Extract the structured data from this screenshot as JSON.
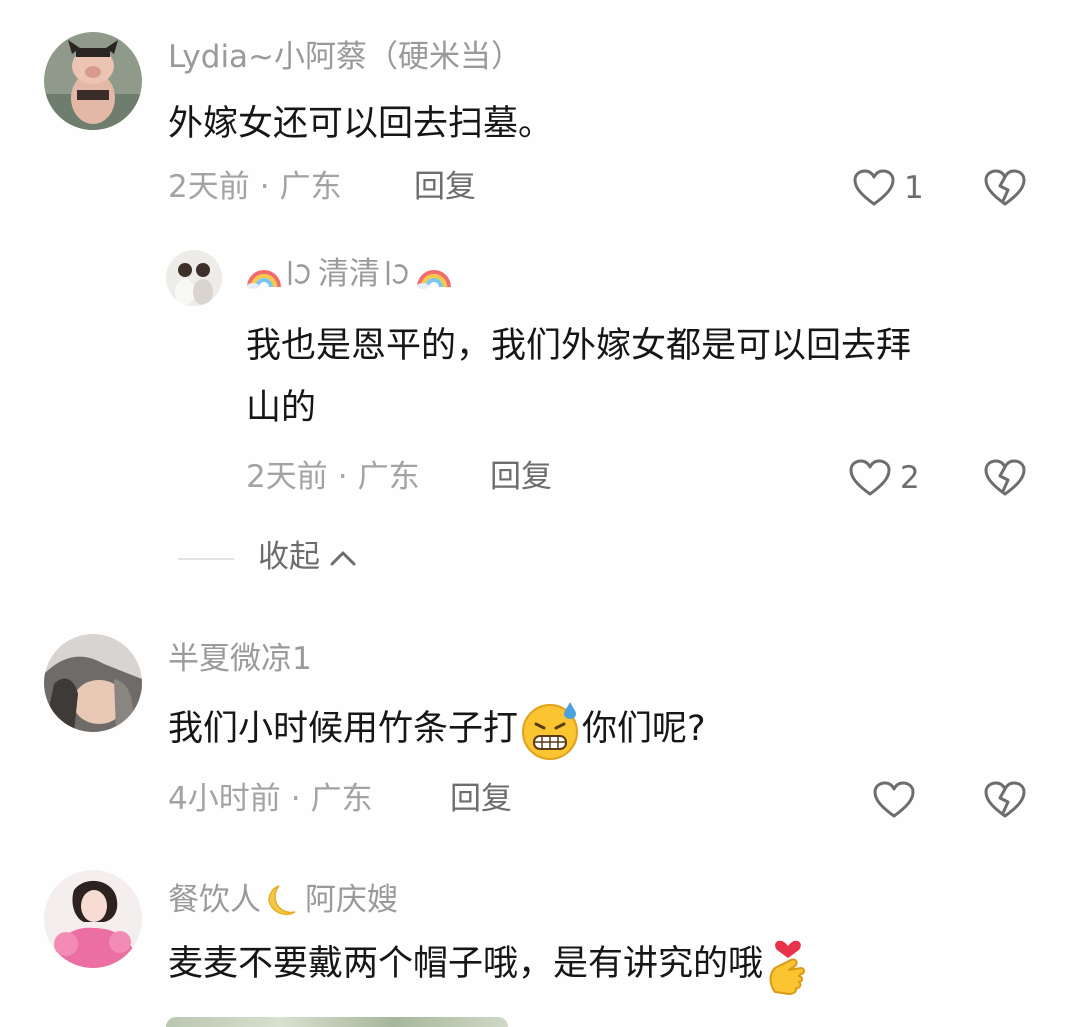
{
  "comments": [
    {
      "username": "Lydia~小阿蔡（硬米当）",
      "text": "外嫁女还可以回去扫墓。",
      "time": "2天前",
      "location": "广东",
      "reply_label": "回复",
      "likes": "1"
    },
    {
      "username_mid": "清清",
      "text_line1": "我也是恩平的，我们外嫁女都是可以回去拜",
      "text_line2": "山的",
      "time": "2天前",
      "location": "广东",
      "reply_label": "回复",
      "likes": "2"
    },
    {
      "username": "半夏微凉1",
      "text_before": "我们小时候用竹条子打",
      "text_after": "你们呢?",
      "time": "4小时前",
      "location": "广东",
      "reply_label": "回复"
    },
    {
      "username_a": "餐饮人",
      "username_b": "阿庆嫂",
      "text": "麦麦不要戴两个帽子哦，是有讲究的哦"
    }
  ],
  "collapse_label": "收起",
  "dot": "·",
  "icons": {
    "like": "heart-outline-icon",
    "dislike": "broken-heart-icon",
    "collapse": "chevron-up-icon"
  }
}
